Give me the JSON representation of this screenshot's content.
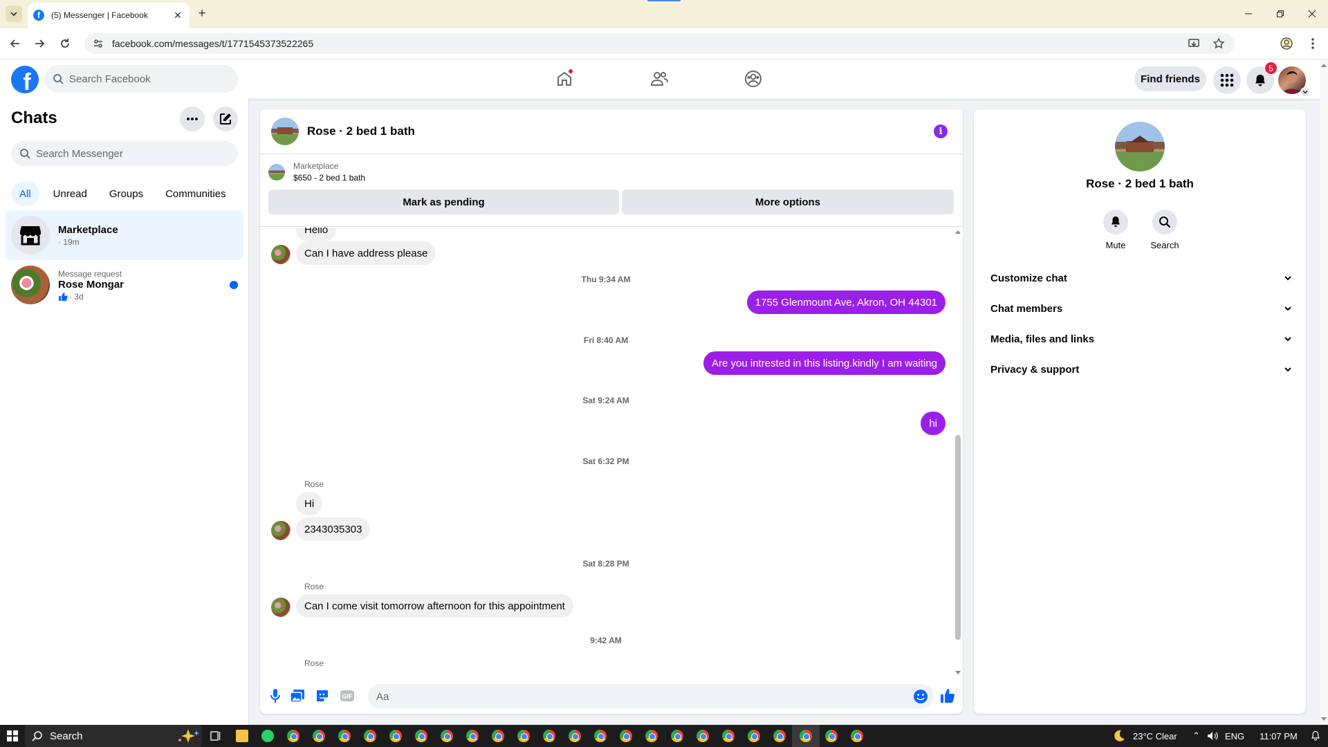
{
  "browser": {
    "tab_title": "(5) Messenger | Facebook",
    "url": "facebook.com/messages/t/1771545373522265"
  },
  "fb_header": {
    "search_placeholder": "Search Facebook",
    "find_friends": "Find friends",
    "notification_count": "5"
  },
  "left": {
    "title": "Chats",
    "search_placeholder": "Search Messenger",
    "filters": [
      "All",
      "Unread",
      "Groups",
      "Communities"
    ],
    "conversations": [
      {
        "name": "Marketplace",
        "sub": "· 19m"
      },
      {
        "request": "Message request",
        "name": "Rose Mongar",
        "sub": "· 3d"
      }
    ]
  },
  "chat": {
    "title": "Rose · 2 bed 1 bath",
    "marketplace_label": "Marketplace",
    "listing": "$650 - 2 bed 1 bath",
    "mark_pending": "Mark as pending",
    "more_options": "More options",
    "composer_placeholder": "Aa",
    "messages": [
      {
        "type": "in",
        "text": "Hello"
      },
      {
        "type": "in",
        "text": "Can I have   address please"
      },
      {
        "type": "stamp",
        "text": "Thu 9:34 AM"
      },
      {
        "type": "out",
        "text": "1755 Glenmount Ave, Akron, OH 44301"
      },
      {
        "type": "stamp",
        "text": "Fri 8:40 AM"
      },
      {
        "type": "out",
        "text": "Are you intrested in this listing.kindly I am waiting"
      },
      {
        "type": "stamp",
        "text": "Sat 9:24 AM"
      },
      {
        "type": "out",
        "text": "hi"
      },
      {
        "type": "stamp",
        "text": "Sat 6:32 PM"
      },
      {
        "type": "sender",
        "text": "Rose"
      },
      {
        "type": "in",
        "text": "Hi"
      },
      {
        "type": "in",
        "text": "2343035303"
      },
      {
        "type": "stamp",
        "text": "Sat 8:28 PM"
      },
      {
        "type": "sender",
        "text": "Rose"
      },
      {
        "type": "in",
        "text": "Can I come visit tomorrow afternoon for this appointment"
      },
      {
        "type": "stamp",
        "text": "9:42 AM"
      },
      {
        "type": "sender",
        "text": "Rose"
      }
    ]
  },
  "details": {
    "name": "Rose · 2 bed 1 bath",
    "mute": "Mute",
    "search": "Search",
    "sections": [
      "Customize chat",
      "Chat members",
      "Media, files and links",
      "Privacy & support"
    ]
  },
  "taskbar": {
    "search": "Search",
    "weather": "23°C  Clear",
    "lang": "ENG",
    "time": "11:07 PM"
  }
}
